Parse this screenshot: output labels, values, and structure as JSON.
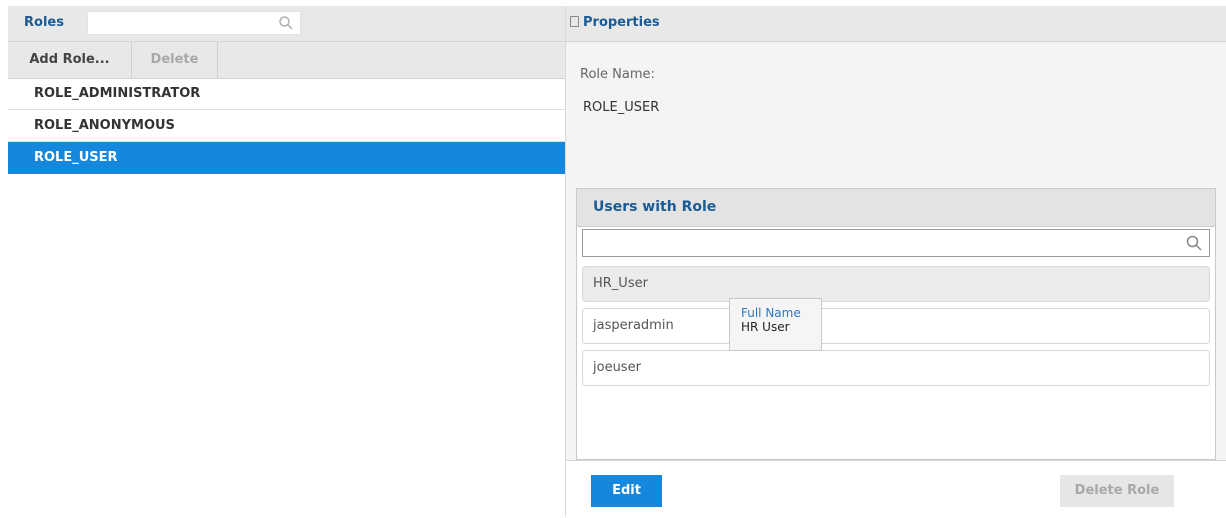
{
  "left": {
    "title": "Roles",
    "search": {
      "value": "",
      "placeholder": ""
    },
    "toolbar": {
      "add_label": "Add Role...",
      "delete_label": "Delete"
    },
    "roles": [
      {
        "label": "ROLE_ADMINISTRATOR",
        "selected": false
      },
      {
        "label": "ROLE_ANONYMOUS",
        "selected": false
      },
      {
        "label": "ROLE_USER",
        "selected": true
      }
    ]
  },
  "right": {
    "title": "Properties",
    "role_name_label": "Role Name:",
    "role_name_value": "ROLE_USER",
    "users": {
      "title": "Users with Role",
      "search": {
        "value": "",
        "placeholder": ""
      },
      "items": [
        {
          "label": "HR_User"
        },
        {
          "label": "jasperadmin"
        },
        {
          "label": "joeuser"
        }
      ]
    },
    "tooltip": {
      "label": "Full Name",
      "value": "HR User"
    },
    "footer": {
      "edit_label": "Edit",
      "delete_role_label": "Delete Role"
    }
  },
  "colors": {
    "accent": "#1587dd",
    "title_text": "#1c5a93",
    "disabled_text": "#a8a8a8",
    "panel_header": "#e8e8e8"
  },
  "icons": [
    "search-icon",
    "panel-pin-icon"
  ]
}
